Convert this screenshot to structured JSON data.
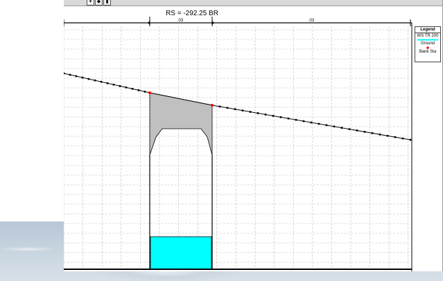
{
  "window": {
    "title": "RS = -292.25  BR",
    "toolbar": {
      "dropdown_icon": "chevron-down-icon",
      "btn1_icon": "bookmark-icon",
      "btn2_icon": "pin-icon"
    }
  },
  "chart_data": {
    "type": "line",
    "title": "RS = -292.25  BR",
    "manning_n": [
      {
        "label": ".03",
        "from": 0,
        "to": 124
      },
      {
        "label": ".03",
        "from": 124,
        "to": 214
      },
      {
        "label": ".03",
        "from": 214,
        "to": 498
      }
    ],
    "legend": {
      "title": "Legend",
      "entries": [
        {
          "name": "WS TR 200",
          "color": "#00ffff"
        },
        {
          "name": "Ground",
          "color": "#000000"
        },
        {
          "name": "Bank Sta",
          "color": "#ff0000"
        }
      ]
    },
    "ground_left_slope": [
      0,
      106,
      124,
      134
    ],
    "ground_right_slope": [
      214,
      152,
      498,
      202
    ],
    "bank_stations": [
      124,
      214
    ],
    "grid": true,
    "colors": {
      "deck": "#c0c0c0",
      "water": "#00ffff",
      "ground": "#000000",
      "bank": "#ff0000"
    }
  }
}
